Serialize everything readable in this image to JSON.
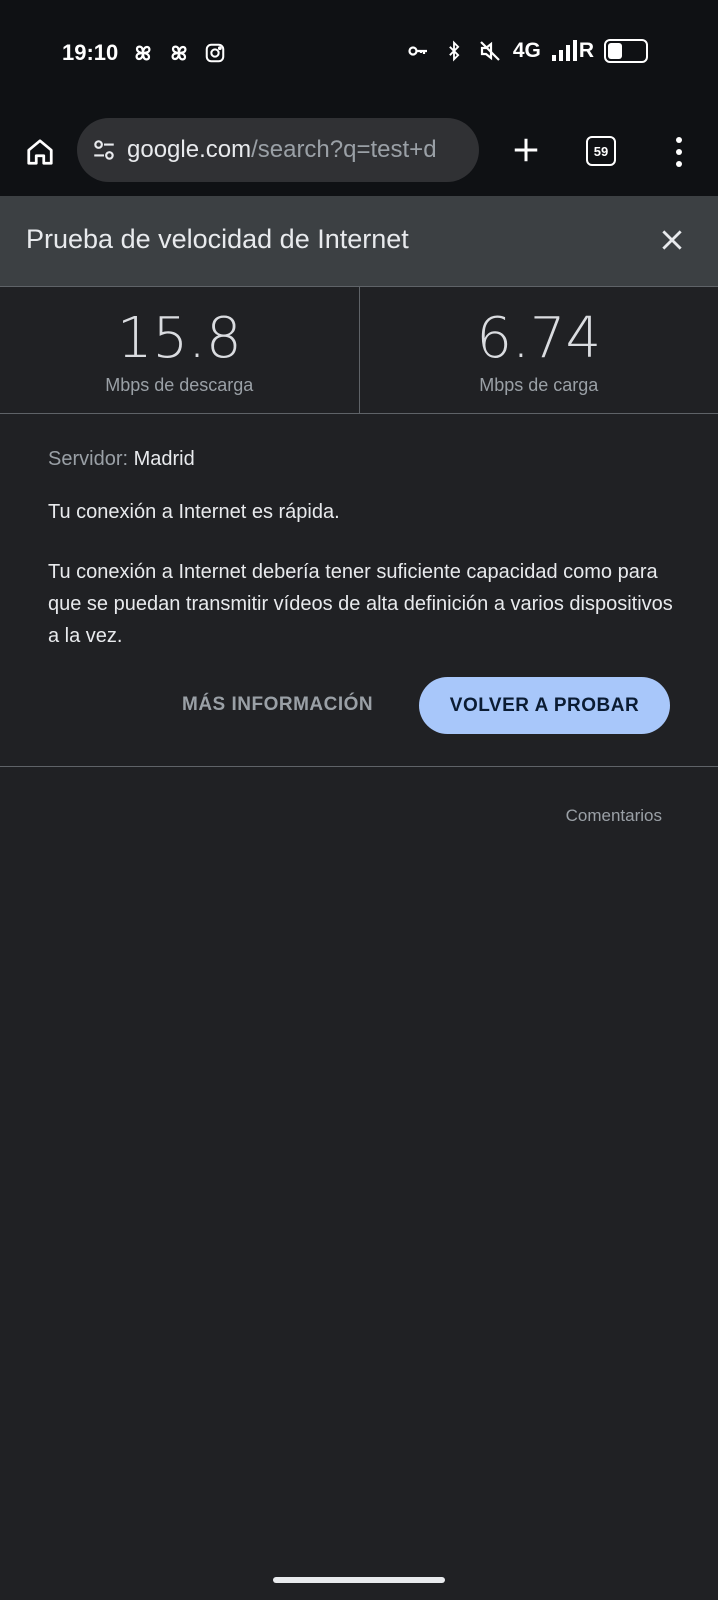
{
  "status_bar": {
    "time": "19:10",
    "network": "4G",
    "roaming": "R",
    "icons": [
      "pinwheel-icon",
      "pinwheel-icon",
      "instagram-icon",
      "vpn-key-icon",
      "bluetooth-icon",
      "mute-icon",
      "signal-icon",
      "battery-icon"
    ]
  },
  "browser": {
    "url_host": "google.com",
    "url_path": "/search?q=test+d",
    "tab_count": "59"
  },
  "panel": {
    "title": "Prueba de velocidad de Internet",
    "download_value": "15.8",
    "download_label": "Mbps de descarga",
    "upload_value": "6.74",
    "upload_label": "Mbps de carga",
    "server_label": "Servidor:",
    "server_value": "Madrid",
    "status_text": "Tu conexión a Internet es rápida.",
    "description": "Tu conexión a Internet debería tener suficiente capacidad como para que se puedan transmitir vídeos de alta definición a varios dispositivos a la vez.",
    "more_info_label": "MÁS INFORMACIÓN",
    "retry_label": "VOLVER A PROBAR",
    "feedback_label": "Comentarios"
  },
  "colors": {
    "background": "#202124",
    "header": "#3c4043",
    "accent_button": "#a8c7fa"
  }
}
